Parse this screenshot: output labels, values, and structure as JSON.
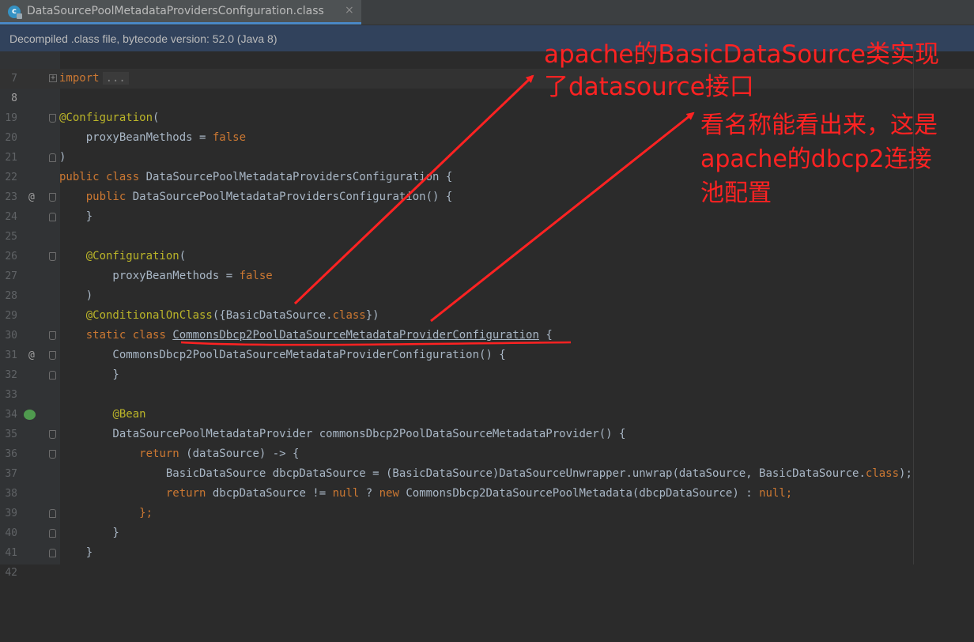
{
  "tab": {
    "title": "DataSourcePoolMetadataProvidersConfiguration.class",
    "icon": "class-file-icon",
    "close": "×"
  },
  "banner": "Decompiled .class file, bytecode version: 52.0 (Java 8)",
  "lines": {
    "l7": {
      "no": "7",
      "code": ""
    },
    "l8": {
      "no": "8",
      "kw": "import",
      "collapsed": "..."
    },
    "l19": {
      "no": "19",
      "code": ""
    },
    "l20": {
      "no": "20",
      "an": "@Configuration",
      "rest": "("
    },
    "l21": {
      "no": "21",
      "pre": "    proxyBeanMethods = ",
      "kw": "false"
    },
    "l22": {
      "no": "22",
      "code": ")"
    },
    "l23": {
      "no": "23",
      "kw1": "public",
      "kw2": "class",
      "rest": "DataSourcePoolMetadataProvidersConfiguration {"
    },
    "l24": {
      "no": "24",
      "kw1": "public",
      "rest": "DataSourcePoolMetadataProvidersConfiguration() {"
    },
    "l25": {
      "no": "25",
      "code": "    }"
    },
    "l26": {
      "no": "26",
      "code": ""
    },
    "l27": {
      "no": "27",
      "an": "@Configuration",
      "rest": "("
    },
    "l28": {
      "no": "28",
      "pre": "        proxyBeanMethods = ",
      "kw": "false"
    },
    "l29": {
      "no": "29",
      "code": "    )"
    },
    "l30": {
      "no": "30",
      "an": "@ConditionalOnClass",
      "mid": "({BasicDataSource.",
      "kw": "class",
      "rest": "})"
    },
    "l31": {
      "no": "31",
      "kw1": "static",
      "kw2": "class",
      "name": "CommonsDbcp2PoolDataSourceMetadataProviderConfiguration",
      "rest": " {"
    },
    "l32": {
      "no": "32",
      "code": "        CommonsDbcp2PoolDataSourceMetadataProviderConfiguration() {"
    },
    "l33": {
      "no": "33",
      "code": "        }"
    },
    "l34": {
      "no": "34",
      "code": ""
    },
    "l35": {
      "no": "35",
      "an": "@Bean"
    },
    "l36": {
      "no": "36",
      "code": "        DataSourcePoolMetadataProvider commonsDbcp2PoolDataSourceMetadataProvider() {"
    },
    "l37": {
      "no": "37",
      "kw": "return",
      "rest": " (dataSource) -> {"
    },
    "l38": {
      "no": "38",
      "pre": "                BasicDataSource dbcpDataSource = (BasicDataSource)DataSourceUnwrapper.unwrap(dataSource, BasicDataSource.",
      "kw": "class",
      "rest": ");"
    },
    "l39": {
      "no": "39",
      "kw1": "return",
      "mid1": " dbcpDataSource != ",
      "kw2": "null",
      "mid2": " ? ",
      "kw3": "new",
      "mid3": " CommonsDbcp2DataSourcePoolMetadata(dbcpDataSource) : ",
      "kw4": "null",
      "kw5": ";"
    },
    "l40": {
      "no": "40",
      "code": "            };"
    },
    "l41": {
      "no": "41",
      "code": "        }"
    },
    "l42": {
      "no": "42",
      "code": "    }"
    }
  },
  "gutter_marks": {
    "override": "@",
    "bean": "bean-icon"
  },
  "annotations": {
    "note1": "apache的BasicDataSource类实现\n了datasource接口",
    "note2": "看名称能看出来，这是\napache的dbcp2连接\n池配置",
    "color": "#ff2222"
  },
  "theme": {
    "editor_bg": "#2b2b2b",
    "keyword": "#cc7832",
    "annotation": "#bbb529",
    "text": "#a9b7c6",
    "banner_bg": "#31425c"
  }
}
